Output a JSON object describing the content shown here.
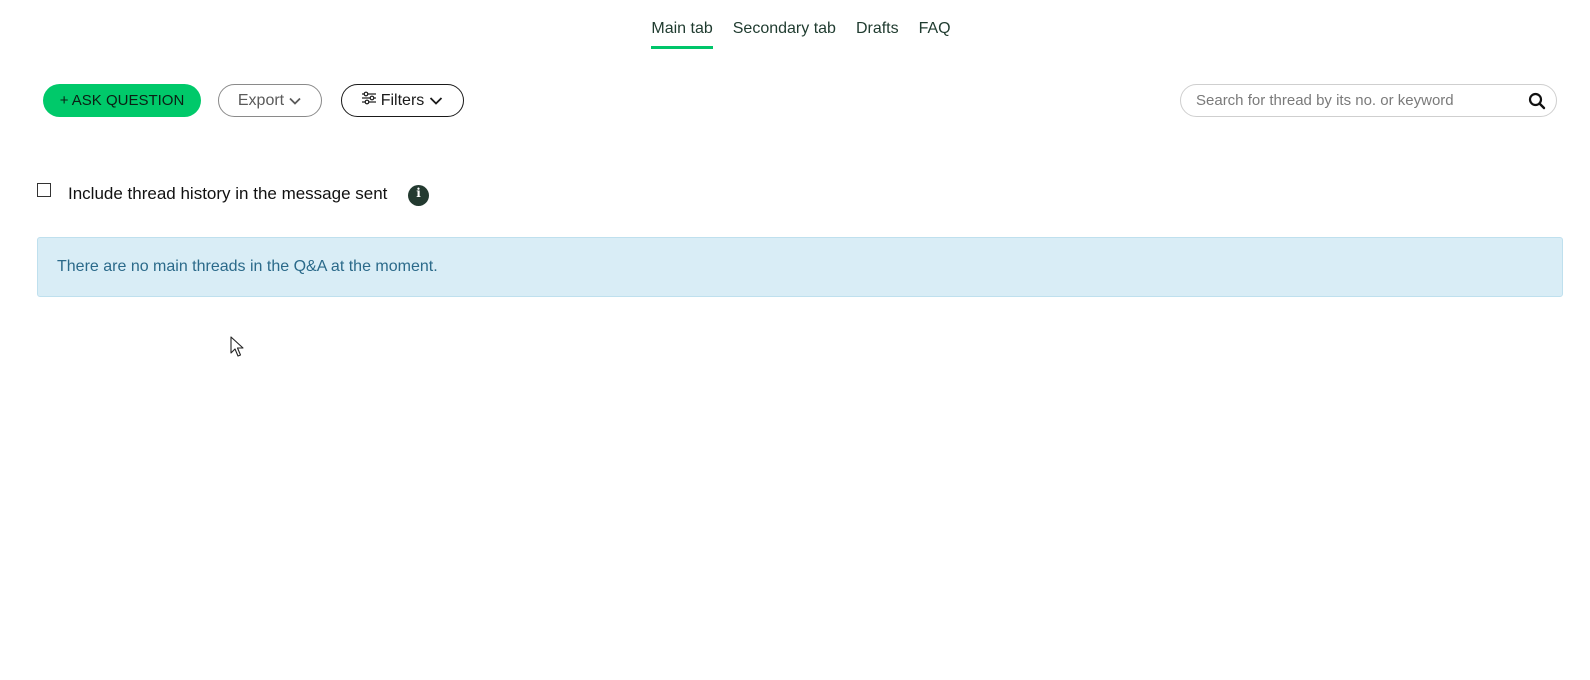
{
  "tabs": [
    {
      "label": "Main tab",
      "active": true
    },
    {
      "label": "Secondary tab",
      "active": false
    },
    {
      "label": "Drafts",
      "active": false
    },
    {
      "label": "FAQ",
      "active": false
    }
  ],
  "toolbar": {
    "ask_label": "+ ASK QUESTION",
    "export_label": "Export",
    "filters_label": "Filters",
    "search_placeholder": "Search for thread by its no. or keyword",
    "search_value": ""
  },
  "options": {
    "include_history_label": "Include thread history in the message sent",
    "include_history_checked": false,
    "info_glyph": "i"
  },
  "alert": {
    "message": "There are no main threads in the Q&A at the moment."
  },
  "colors": {
    "accent": "#00c96a",
    "tab_underline": "#00c56a",
    "alert_bg": "#d9edf6",
    "alert_text": "#2b6a8a",
    "info_icon_bg": "#233a30"
  },
  "icons": {
    "filters": "sliders-icon",
    "dropdown": "chevron-down-icon",
    "search": "search-icon",
    "info": "info-icon",
    "cursor": "mouse-pointer-icon"
  }
}
